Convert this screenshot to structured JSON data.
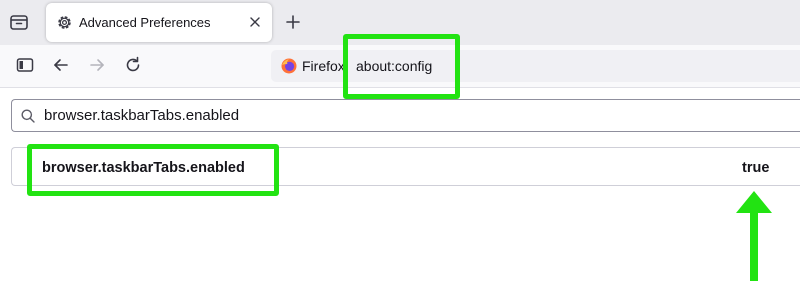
{
  "tab": {
    "title": "Advanced Preferences"
  },
  "urlbar": {
    "identity": "Firefox",
    "url": "about:config"
  },
  "search": {
    "value": "browser.taskbarTabs.enabled"
  },
  "preference": {
    "name": "browser.taskbarTabs.enabled",
    "value": "true"
  },
  "annotation_color": "#22e312",
  "icons": [
    "tab-list-icon",
    "gear-icon",
    "close-icon",
    "plus-icon",
    "sidebar-icon",
    "back-arrow-icon",
    "forward-arrow-icon",
    "reload-icon",
    "firefox-logo-icon",
    "search-icon",
    "green-arrow-icon"
  ]
}
